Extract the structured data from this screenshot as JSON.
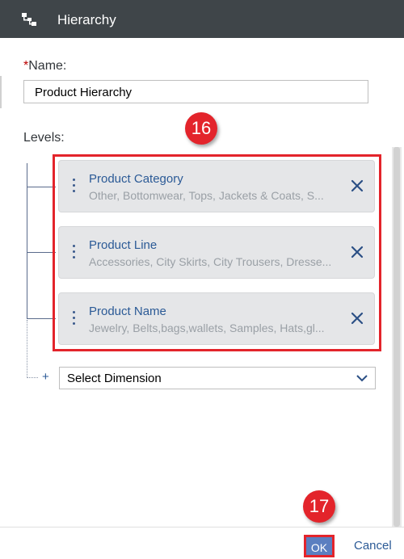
{
  "dialog": {
    "title": "Hierarchy",
    "title_icon": "hierarchy-icon"
  },
  "form": {
    "name_required_marker": "*",
    "name_label": "Name:",
    "name_value": "Product Hierarchy",
    "levels_label": "Levels:"
  },
  "levels": [
    {
      "name": "Product Category",
      "members": "Other, Bottomwear, Tops, Jackets & Coats, S..."
    },
    {
      "name": "Product Line",
      "members": "Accessories, City Skirts, City Trousers, Dresse..."
    },
    {
      "name": "Product Name",
      "members": "Jewelry, Belts,bags,wallets, Samples, Hats,gl..."
    }
  ],
  "add_level": {
    "plus_symbol": "+",
    "select_value": "Select Dimension"
  },
  "footer": {
    "ok_label": "OK",
    "cancel_label": "Cancel"
  },
  "annotations": {
    "badge_levels": "16",
    "badge_ok": "17"
  },
  "colors": {
    "titlebar": "#3f4549",
    "accent": "#2b5a96",
    "highlight": "#e3242b",
    "ok_button": "#5b7fc0"
  }
}
